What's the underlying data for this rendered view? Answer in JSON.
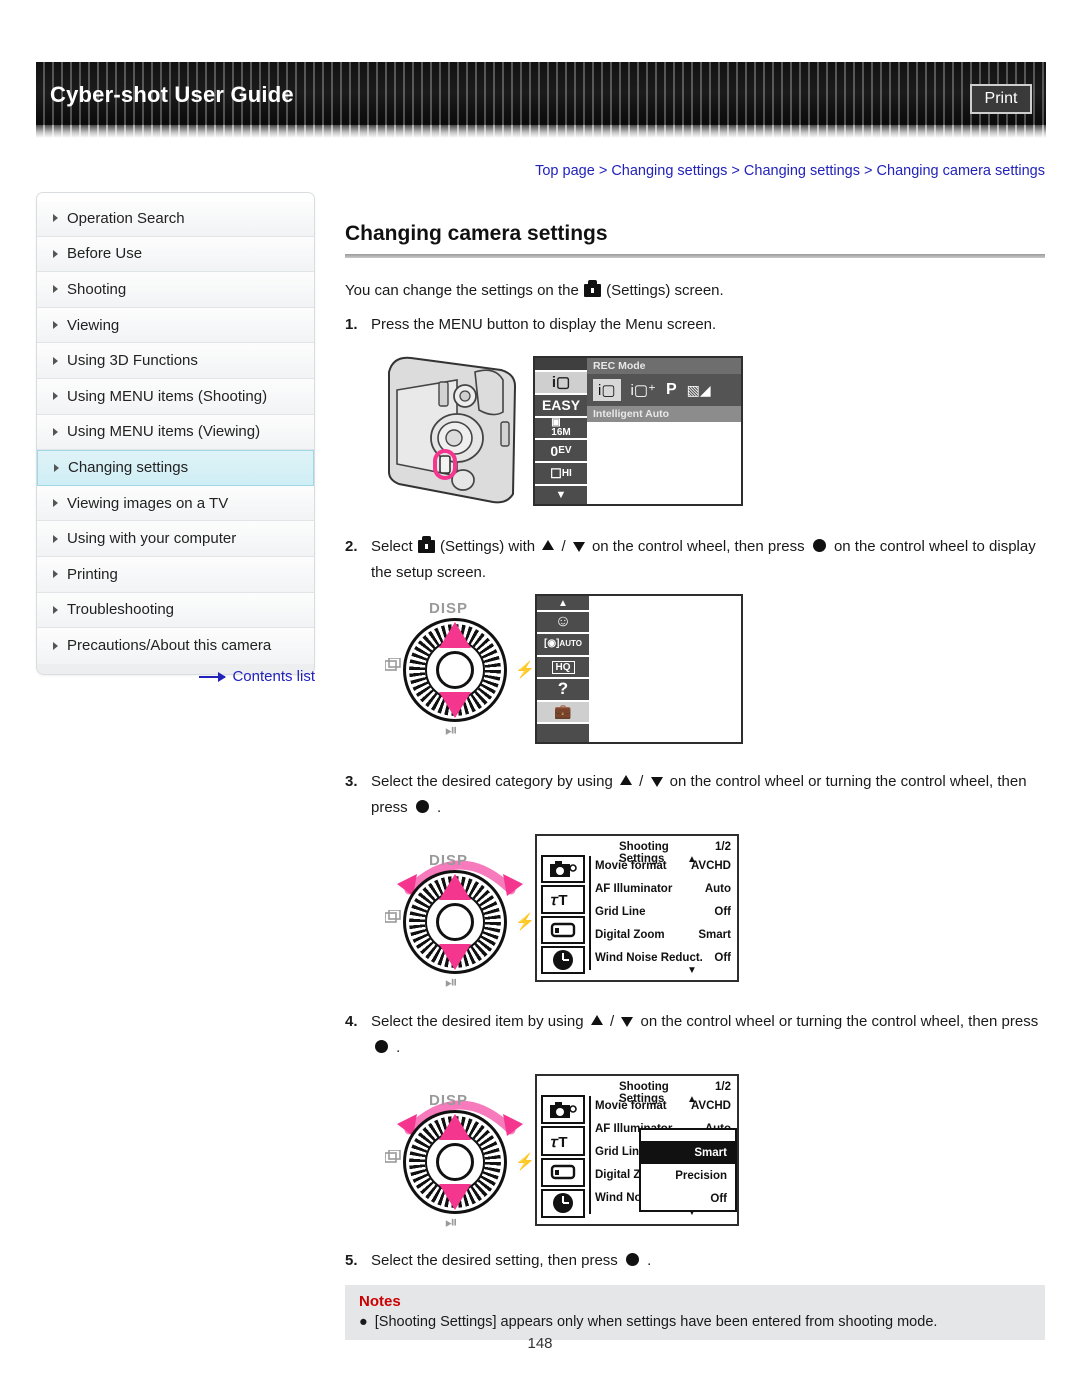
{
  "header": {
    "guide_title": "Cyber-shot User Guide",
    "print_label": "Print"
  },
  "breadcrumb": {
    "items": [
      "Top page",
      "Changing settings",
      "Changing settings",
      "Changing camera settings"
    ],
    "separator": ">",
    "link_color": "#2222bb"
  },
  "sidebar": {
    "items": [
      {
        "label": "Operation Search",
        "active": false
      },
      {
        "label": "Before Use",
        "active": false
      },
      {
        "label": "Shooting",
        "active": false
      },
      {
        "label": "Viewing",
        "active": false
      },
      {
        "label": "Using 3D Functions",
        "active": false
      },
      {
        "label": "Using MENU items (Shooting)",
        "active": false
      },
      {
        "label": "Using MENU items (Viewing)",
        "active": false
      },
      {
        "label": "Changing settings",
        "active": true
      },
      {
        "label": "Viewing images on a TV",
        "active": false
      },
      {
        "label": "Using with your computer",
        "active": false
      },
      {
        "label": "Printing",
        "active": false
      },
      {
        "label": "Troubleshooting",
        "active": false
      },
      {
        "label": "Precautions/About this camera",
        "active": false
      }
    ],
    "contents_list_label": "Contents list",
    "active_highlight_color": "#cfeef5"
  },
  "main": {
    "heading": "Changing camera settings",
    "intro_before": "You can change the settings on the",
    "intro_after": "(Settings) screen.",
    "steps": [
      {
        "num": "1.",
        "text": "Press the MENU button to display the Menu screen."
      },
      {
        "num": "2.",
        "part1": "Select",
        "part2": "(Settings) with",
        "part3": "/",
        "part4": "on the control wheel, then press",
        "part5": "on the control wheel to display the setup screen."
      },
      {
        "num": "3.",
        "part1": "Select the desired category by using",
        "part2": "/",
        "part3": "on the control wheel or turning the control wheel, then press",
        "part4": "."
      },
      {
        "num": "4.",
        "part1": "Select the desired item by using",
        "part2": "/",
        "part3": "on the control wheel or turning the control wheel, then press",
        "part4": "."
      },
      {
        "num": "5.",
        "part1": "Select the desired setting, then press",
        "part2": "."
      }
    ]
  },
  "figure_rec_mode": {
    "rail": [
      "iA",
      "EASY",
      "16M",
      "0EV",
      "HI",
      "down"
    ],
    "header_label": "REC Mode",
    "modes": [
      "iA",
      "iA+",
      "P",
      "movie"
    ],
    "selected_mode": "iA",
    "mode_caption": "Intelligent Auto"
  },
  "figure_wheel": {
    "label_disp": "DISP",
    "label_flash": "flash-icon",
    "label_burst": "burst-icon",
    "label_timer": "self-timer-icon",
    "highlight_color": "#f4368f"
  },
  "figure_setup": {
    "rail": [
      "up",
      "smile",
      "auto-frame",
      "movie-hq",
      "question",
      "settings",
      "blank"
    ],
    "selected_index": 5
  },
  "figure_shooting_settings": {
    "title": "Shooting Settings",
    "page_indicator": "1/2",
    "rows": [
      {
        "label": "Movie format",
        "value": "AVCHD"
      },
      {
        "label": "AF Illuminator",
        "value": "Auto"
      },
      {
        "label": "Grid Line",
        "value": "Off"
      },
      {
        "label": "Digital Zoom",
        "value": "Smart"
      },
      {
        "label": "Wind Noise Reduct.",
        "value": "Off"
      }
    ],
    "rail_icons": [
      "camera-icon",
      "wrench-icon",
      "screen-icon",
      "clock-icon"
    ]
  },
  "figure_shooting_settings_dropdown": {
    "title": "Shooting Settings",
    "page_indicator": "1/2",
    "rows": [
      {
        "label": "Movie format",
        "value": "AVCHD"
      },
      {
        "label": "AF Illuminator",
        "value": "Auto"
      },
      {
        "label": "Grid Line",
        "value": ""
      },
      {
        "label": "Digital Zoom",
        "value": ""
      },
      {
        "label": "Wind Noise Redu",
        "value": ""
      }
    ],
    "dropdown_options": [
      "Smart",
      "Precision",
      "Off"
    ],
    "dropdown_selected": "Smart"
  },
  "notes": {
    "title": "Notes",
    "items": [
      "[Shooting Settings] appears only when settings have been entered from shooting mode."
    ],
    "title_color": "#cc0000"
  },
  "footer": {
    "page_number": "148"
  }
}
